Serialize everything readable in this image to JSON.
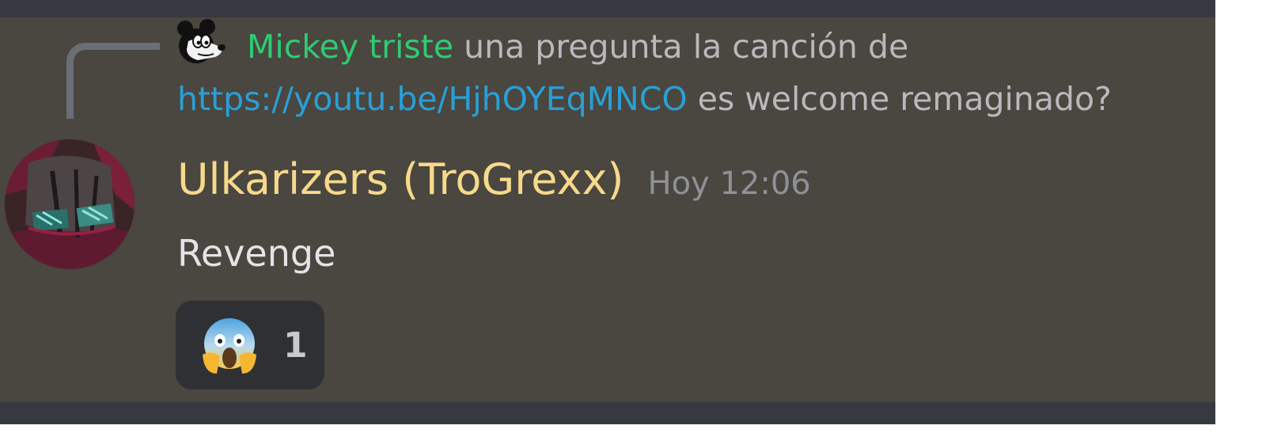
{
  "reply": {
    "author": "Mickey triste",
    "text_before_link": " una pregunta  la canción de ",
    "link": "https://youtu.be/HjhOYEqMNCO",
    "text_after_link": " es welcome remaginado?",
    "author_color": "#2ecc71",
    "link_color": "#2a9fd6",
    "avatar_icon": "mickey-avatar-icon"
  },
  "message": {
    "author": "Ulkarizers (TroGrexx)",
    "timestamp": "Hoy 12:06",
    "content": "Revenge",
    "author_color": "#f6d98a",
    "avatar_icon": "user-avatar-icon"
  },
  "reactions": [
    {
      "emoji_icon": "screaming-face-icon",
      "count": "1"
    }
  ],
  "colors": {
    "frame_bg": "#36393f",
    "highlighted_message_bg": "#4a4640",
    "reaction_bg": "#2f3033"
  }
}
